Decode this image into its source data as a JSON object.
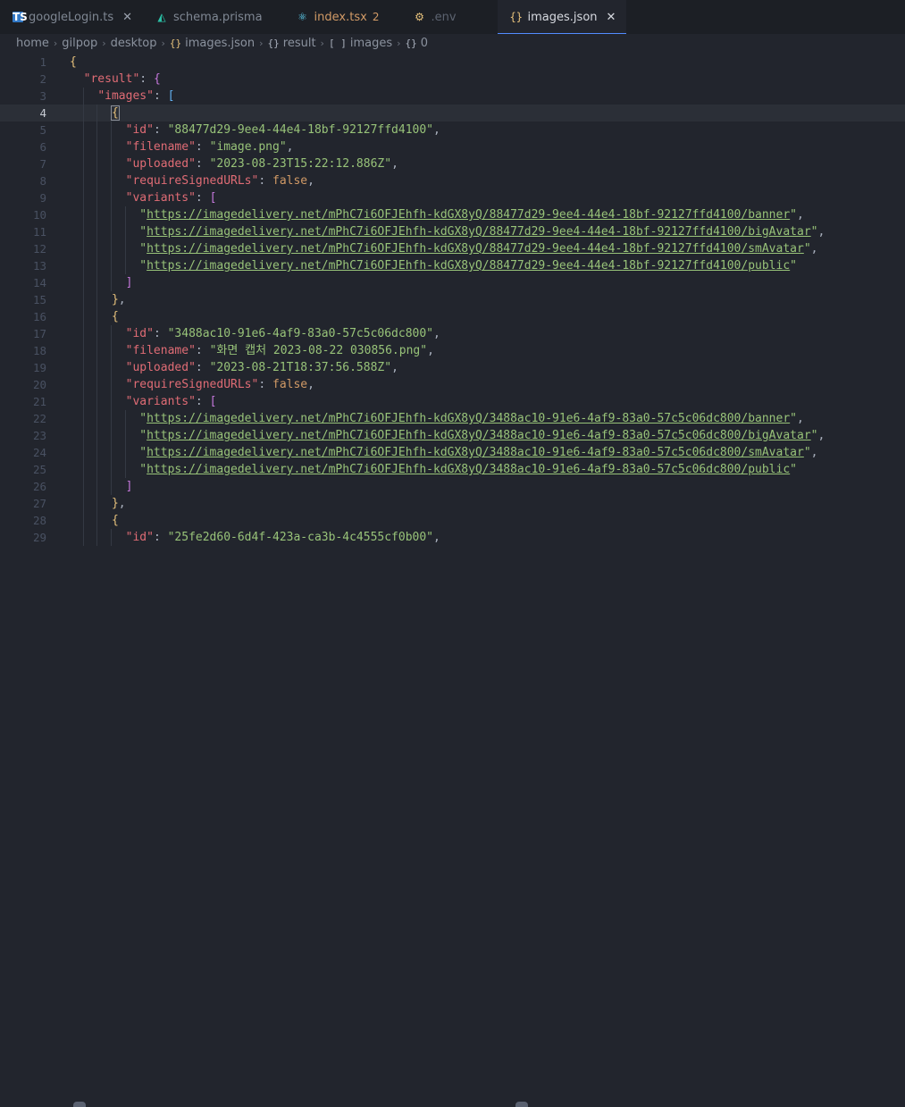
{
  "tabs": [
    {
      "label": "googleLogin.ts",
      "icon": "ts-icon",
      "badge": "",
      "active": false
    },
    {
      "label": "schema.prisma",
      "icon": "prisma-icon",
      "badge": "",
      "active": false
    },
    {
      "label": "index.tsx",
      "icon": "react-icon",
      "badge": "2",
      "active": false
    },
    {
      "label": ".env",
      "icon": "env-icon",
      "badge": "",
      "active": false
    },
    {
      "label": "images.json",
      "icon": "json-icon",
      "badge": "",
      "active": true
    }
  ],
  "breadcrumb": [
    "home",
    "gilpop",
    "desktop",
    "images.json",
    "result",
    "images",
    "0"
  ],
  "editor": {
    "current_line": 4,
    "lines": [
      {
        "n": "1",
        "t": [
          [
            "b1",
            "{"
          ]
        ]
      },
      {
        "n": "2",
        "t": [
          [
            "p",
            "  "
          ],
          [
            "k",
            "\"result\""
          ],
          [
            "p",
            ": "
          ],
          [
            "b2",
            "{"
          ]
        ]
      },
      {
        "n": "3",
        "t": [
          [
            "p",
            "    "
          ],
          [
            "k",
            "\"images\""
          ],
          [
            "p",
            ": "
          ],
          [
            "b3",
            "["
          ]
        ]
      },
      {
        "n": "4",
        "t": [
          [
            "p",
            "      "
          ],
          [
            "b1",
            "{"
          ]
        ]
      },
      {
        "n": "5",
        "t": [
          [
            "p",
            "        "
          ],
          [
            "k",
            "\"id\""
          ],
          [
            "p",
            ": "
          ],
          [
            "s",
            "\"88477d29-9ee4-44e4-18bf-92127ffd4100\""
          ],
          [
            "p",
            ","
          ]
        ]
      },
      {
        "n": "6",
        "t": [
          [
            "p",
            "        "
          ],
          [
            "k",
            "\"filename\""
          ],
          [
            "p",
            ": "
          ],
          [
            "s",
            "\"image.png\""
          ],
          [
            "p",
            ","
          ]
        ]
      },
      {
        "n": "7",
        "t": [
          [
            "p",
            "        "
          ],
          [
            "k",
            "\"uploaded\""
          ],
          [
            "p",
            ": "
          ],
          [
            "s",
            "\"2023-08-23T15:22:12.886Z\""
          ],
          [
            "p",
            ","
          ]
        ]
      },
      {
        "n": "8",
        "t": [
          [
            "p",
            "        "
          ],
          [
            "k",
            "\"requireSignedURLs\""
          ],
          [
            "p",
            ": "
          ],
          [
            "kw",
            "false"
          ],
          [
            "p",
            ","
          ]
        ]
      },
      {
        "n": "9",
        "t": [
          [
            "p",
            "        "
          ],
          [
            "k",
            "\"variants\""
          ],
          [
            "p",
            ": "
          ],
          [
            "b2",
            "["
          ]
        ]
      },
      {
        "n": "10",
        "t": [
          [
            "p",
            "          "
          ],
          [
            "s",
            "\""
          ],
          [
            "u",
            "https://imagedelivery.net/mPhC7i6OFJEhfh-kdGX8yQ/88477d29-9ee4-44e4-18bf-92127ffd4100/banner"
          ],
          [
            "s",
            "\""
          ],
          [
            "p",
            ","
          ]
        ]
      },
      {
        "n": "11",
        "t": [
          [
            "p",
            "          "
          ],
          [
            "s",
            "\""
          ],
          [
            "u",
            "https://imagedelivery.net/mPhC7i6OFJEhfh-kdGX8yQ/88477d29-9ee4-44e4-18bf-92127ffd4100/bigAvatar"
          ],
          [
            "s",
            "\""
          ],
          [
            "p",
            ","
          ]
        ]
      },
      {
        "n": "12",
        "t": [
          [
            "p",
            "          "
          ],
          [
            "s",
            "\""
          ],
          [
            "u",
            "https://imagedelivery.net/mPhC7i6OFJEhfh-kdGX8yQ/88477d29-9ee4-44e4-18bf-92127ffd4100/smAvatar"
          ],
          [
            "s",
            "\""
          ],
          [
            "p",
            ","
          ]
        ]
      },
      {
        "n": "13",
        "t": [
          [
            "p",
            "          "
          ],
          [
            "s",
            "\""
          ],
          [
            "u",
            "https://imagedelivery.net/mPhC7i6OFJEhfh-kdGX8yQ/88477d29-9ee4-44e4-18bf-92127ffd4100/public"
          ],
          [
            "s",
            "\""
          ]
        ]
      },
      {
        "n": "14",
        "t": [
          [
            "p",
            "        "
          ],
          [
            "b2",
            "]"
          ]
        ]
      },
      {
        "n": "15",
        "t": [
          [
            "p",
            "      "
          ],
          [
            "b1",
            "}"
          ],
          [
            "p",
            ","
          ]
        ]
      },
      {
        "n": "16",
        "t": [
          [
            "p",
            "      "
          ],
          [
            "b1",
            "{"
          ]
        ]
      },
      {
        "n": "17",
        "t": [
          [
            "p",
            "        "
          ],
          [
            "k",
            "\"id\""
          ],
          [
            "p",
            ": "
          ],
          [
            "s",
            "\"3488ac10-91e6-4af9-83a0-57c5c06dc800\""
          ],
          [
            "p",
            ","
          ]
        ]
      },
      {
        "n": "18",
        "t": [
          [
            "p",
            "        "
          ],
          [
            "k",
            "\"filename\""
          ],
          [
            "p",
            ": "
          ],
          [
            "s",
            "\"화면 캡처 2023-08-22 030856.png\""
          ],
          [
            "p",
            ","
          ]
        ]
      },
      {
        "n": "19",
        "t": [
          [
            "p",
            "        "
          ],
          [
            "k",
            "\"uploaded\""
          ],
          [
            "p",
            ": "
          ],
          [
            "s",
            "\"2023-08-21T18:37:56.588Z\""
          ],
          [
            "p",
            ","
          ]
        ]
      },
      {
        "n": "20",
        "t": [
          [
            "p",
            "        "
          ],
          [
            "k",
            "\"requireSignedURLs\""
          ],
          [
            "p",
            ": "
          ],
          [
            "kw",
            "false"
          ],
          [
            "p",
            ","
          ]
        ]
      },
      {
        "n": "21",
        "t": [
          [
            "p",
            "        "
          ],
          [
            "k",
            "\"variants\""
          ],
          [
            "p",
            ": "
          ],
          [
            "b2",
            "["
          ]
        ]
      },
      {
        "n": "22",
        "t": [
          [
            "p",
            "          "
          ],
          [
            "s",
            "\""
          ],
          [
            "u",
            "https://imagedelivery.net/mPhC7i6OFJEhfh-kdGX8yQ/3488ac10-91e6-4af9-83a0-57c5c06dc800/banner"
          ],
          [
            "s",
            "\""
          ],
          [
            "p",
            ","
          ]
        ]
      },
      {
        "n": "23",
        "t": [
          [
            "p",
            "          "
          ],
          [
            "s",
            "\""
          ],
          [
            "u",
            "https://imagedelivery.net/mPhC7i6OFJEhfh-kdGX8yQ/3488ac10-91e6-4af9-83a0-57c5c06dc800/bigAvatar"
          ],
          [
            "s",
            "\""
          ],
          [
            "p",
            ","
          ]
        ]
      },
      {
        "n": "24",
        "t": [
          [
            "p",
            "          "
          ],
          [
            "s",
            "\""
          ],
          [
            "u",
            "https://imagedelivery.net/mPhC7i6OFJEhfh-kdGX8yQ/3488ac10-91e6-4af9-83a0-57c5c06dc800/smAvatar"
          ],
          [
            "s",
            "\""
          ],
          [
            "p",
            ","
          ]
        ]
      },
      {
        "n": "25",
        "t": [
          [
            "p",
            "          "
          ],
          [
            "s",
            "\""
          ],
          [
            "u",
            "https://imagedelivery.net/mPhC7i6OFJEhfh-kdGX8yQ/3488ac10-91e6-4af9-83a0-57c5c06dc800/public"
          ],
          [
            "s",
            "\""
          ]
        ]
      },
      {
        "n": "26",
        "t": [
          [
            "p",
            "        "
          ],
          [
            "b2",
            "]"
          ]
        ]
      },
      {
        "n": "27",
        "t": [
          [
            "p",
            "      "
          ],
          [
            "b1",
            "}"
          ],
          [
            "p",
            ","
          ]
        ]
      },
      {
        "n": "28",
        "t": [
          [
            "p",
            "      "
          ],
          [
            "b1",
            "{"
          ]
        ]
      },
      {
        "n": "29",
        "t": [
          [
            "p",
            "        "
          ],
          [
            "k",
            "\"id\""
          ],
          [
            "p",
            ": "
          ],
          [
            "s",
            "\"25fe2d60-6d4f-423a-ca3b-4c4555cf0b00\""
          ],
          [
            "p",
            ","
          ]
        ]
      }
    ]
  }
}
